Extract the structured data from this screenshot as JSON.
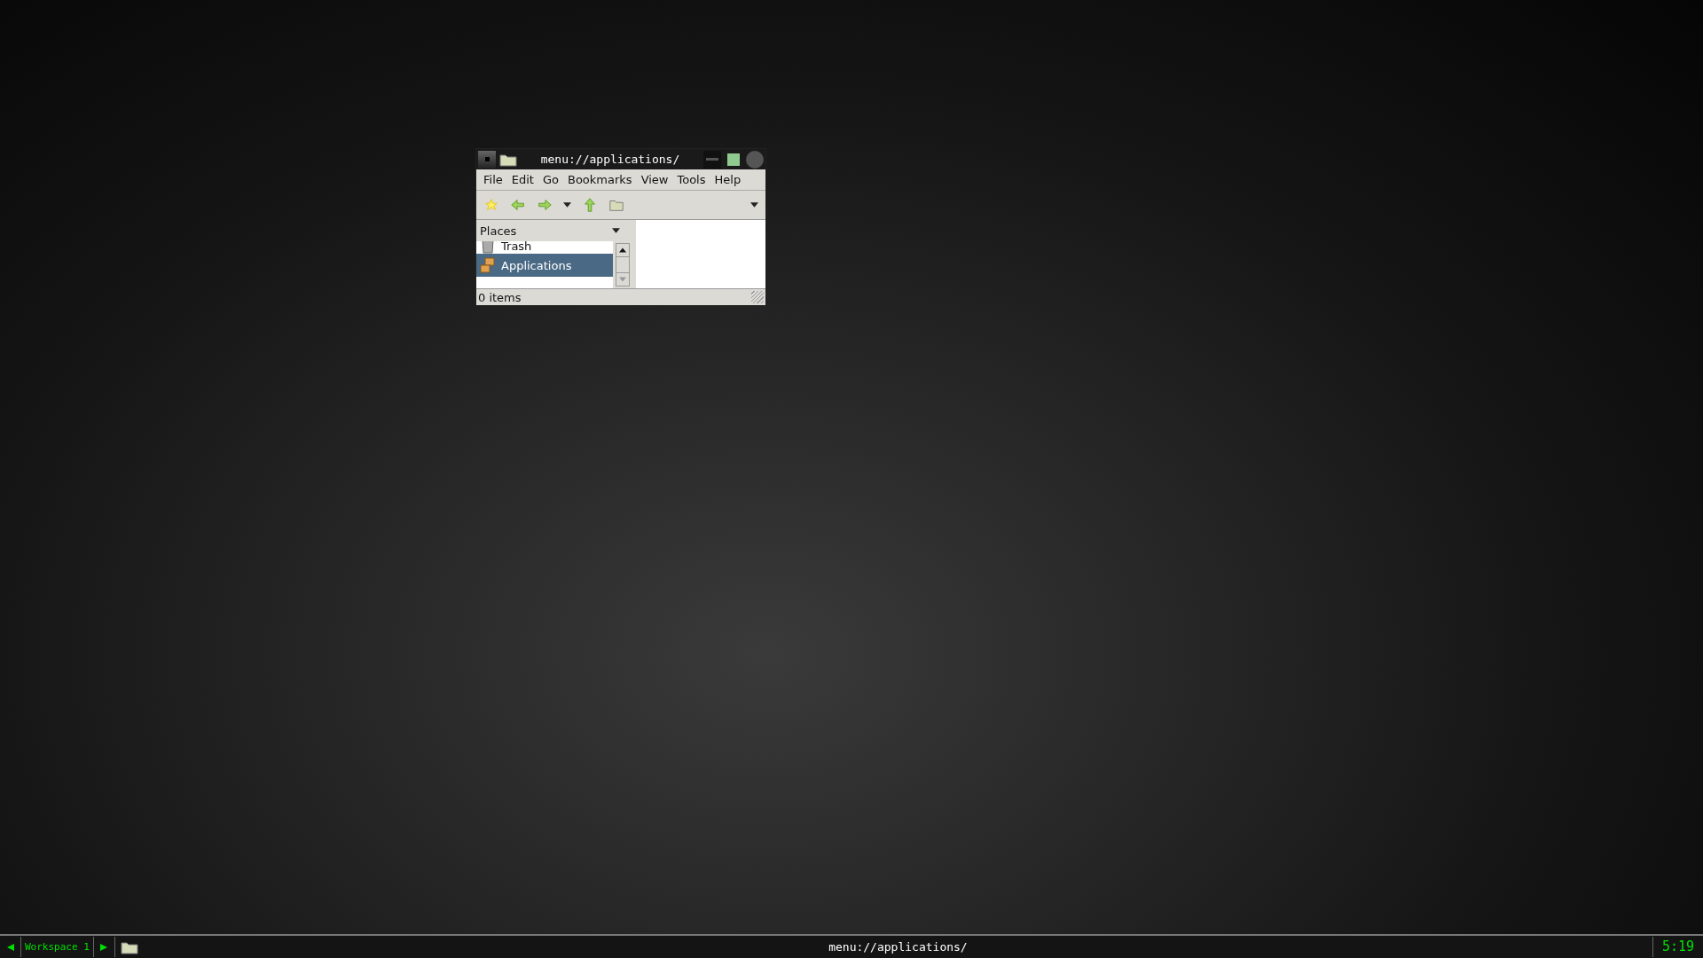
{
  "window": {
    "title": "menu://applications/"
  },
  "menu": [
    "File",
    "Edit",
    "Go",
    "Bookmarks",
    "View",
    "Tools",
    "Help"
  ],
  "sidebar": {
    "header": "Places",
    "items": [
      {
        "label": "Trash",
        "kind": "trash",
        "selected": false
      },
      {
        "label": "Applications",
        "kind": "apps",
        "selected": true
      }
    ]
  },
  "status_bar": "0 items",
  "taskbar": {
    "workspace": "Workspace 1",
    "task_title": "menu://applications/",
    "clock": "5:19"
  }
}
